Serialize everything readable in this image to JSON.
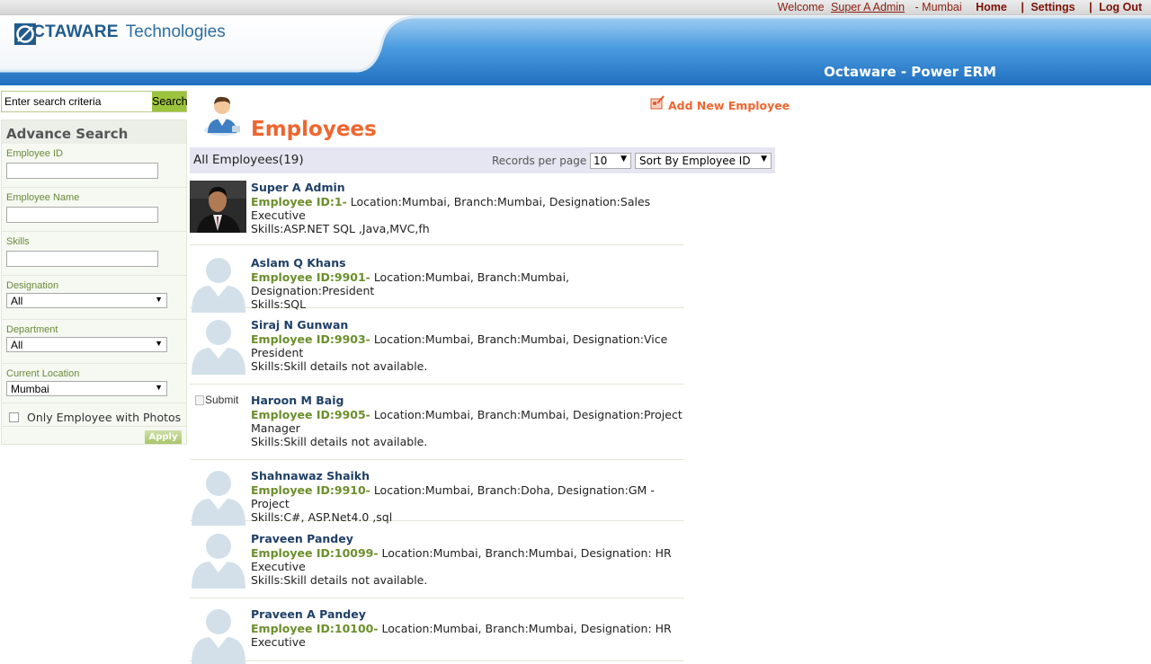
{
  "topbar": {
    "welcome": "Welcome",
    "user": "Super A Admin",
    "location": "- Mumbai",
    "home": "Home",
    "settings": "Settings",
    "logout": "Log Out",
    "separator": "|"
  },
  "header": {
    "brand_bold": "OCTAWARE",
    "brand_rest": "Technologies",
    "product": "Octaware - Power ERM",
    "logo_color": "#1f5b8c",
    "banner_color": "#2e86cf"
  },
  "search": {
    "value": "Enter search criteria",
    "button": "Search"
  },
  "advance_search": {
    "title": "Advance Search",
    "employee_id_label": "Employee ID",
    "employee_name_label": "Employee Name",
    "skills_label": "Skills",
    "designation_label": "Designation",
    "designation_value": "All",
    "department_label": "Department",
    "department_value": "All",
    "location_label": "Current Location",
    "location_value": "Mumbai",
    "photos_label": "Only Employee with Photos",
    "apply": "Apply"
  },
  "main": {
    "title": "Employees",
    "add_new": "Add New Employee",
    "all_employees": "All Employees(19)",
    "records_per_page_label": "Records per page",
    "records_per_page": "10",
    "sort": "Sort By Employee ID"
  },
  "employees": [
    {
      "name": "Super A Admin",
      "id": "Employee ID:1-",
      "details": " Location:Mumbai, Branch:Mumbai, Designation:Sales Executive",
      "skills": "Skills:ASP.NET SQL ,Java,MVC,fh",
      "photo": "real-photo"
    },
    {
      "name": "Aslam Q Khans",
      "id": "Employee ID:9901-",
      "details": " Location:Mumbai, Branch:Mumbai, Designation:President",
      "skills": "Skills:SQL",
      "photo": "placeholder"
    },
    {
      "name": "Siraj N Gunwan",
      "id": "Employee ID:9903-",
      "details": " Location:Mumbai, Branch:Mumbai, Designation:Vice President",
      "skills": "Skills:Skill details not available.",
      "photo": "placeholder"
    },
    {
      "name": "Haroon M Baig",
      "id": "Employee ID:9905-",
      "details": " Location:Mumbai, Branch:Mumbai, Designation:Project Manager",
      "skills": "Skills:Skill details not available.",
      "photo": "broken",
      "broken_alt": "Submit"
    },
    {
      "name": "Shahnawaz Shaikh",
      "id": "Employee ID:9910-",
      "details": " Location:Mumbai, Branch:Doha, Designation:GM - Project",
      "skills": "Skills:C#, ASP.Net4.0 ,sql",
      "photo": "placeholder"
    },
    {
      "name": "Praveen Pandey",
      "id": "Employee ID:10099-",
      "details": " Location:Mumbai, Branch:Mumbai, Designation: HR Executive",
      "skills": "Skills:Skill details not available.",
      "photo": "placeholder"
    },
    {
      "name": "Praveen A Pandey",
      "id": "Employee ID:10100-",
      "details": " Location:Mumbai, Branch:Mumbai, Designation: HR Executive",
      "skills": "",
      "photo": "placeholder"
    }
  ]
}
